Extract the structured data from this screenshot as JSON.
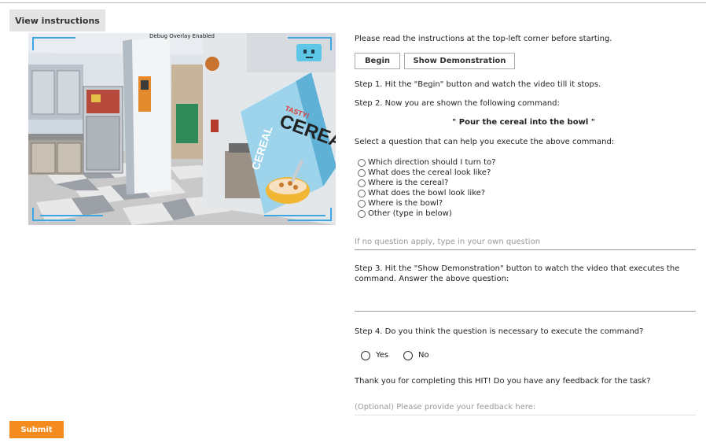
{
  "buttons": {
    "view_instructions": "View instructions",
    "begin": "Begin",
    "show_demo": "Show Demonstration",
    "submit": "Submit"
  },
  "video": {
    "overlay_title": "Debug Overlay Enabled",
    "cereal_brand": "CEREAL",
    "cereal_tag": "TASTY!"
  },
  "instructions": {
    "intro": "Please read the instructions at the top-left corner before starting.",
    "step1": "Step 1. Hit the \"Begin\" button and watch the video till it stops.",
    "step2": "Step 2. Now you are shown the following command:",
    "command": "\" Pour the cereal into the bowl \"",
    "select_prompt": "Select a question that can help you execute the above command:",
    "questions": [
      "Which direction should I turn to?",
      "What does the cereal look like?",
      "Where is the cereal?",
      "What does the bowl look like?",
      "Where is the bowl?",
      "Other (type in below)"
    ],
    "own_question_placeholder": "If no question apply, type in your own question",
    "step3": "Step 3. Hit the \"Show Demonstration\" button to watch the video that executes the command. Answer the above question:",
    "step4": "Step 4. Do you think the question is necessary to execute the command?",
    "yes": "Yes",
    "no": "No",
    "thanks": "Thank you for completing this HIT! Do you have any feedback for the task?",
    "feedback_placeholder": "(Optional) Please provide your feedback here:"
  },
  "colors": {
    "submit": "#f48b1f",
    "overlay_corners": "#3fa7e0"
  }
}
